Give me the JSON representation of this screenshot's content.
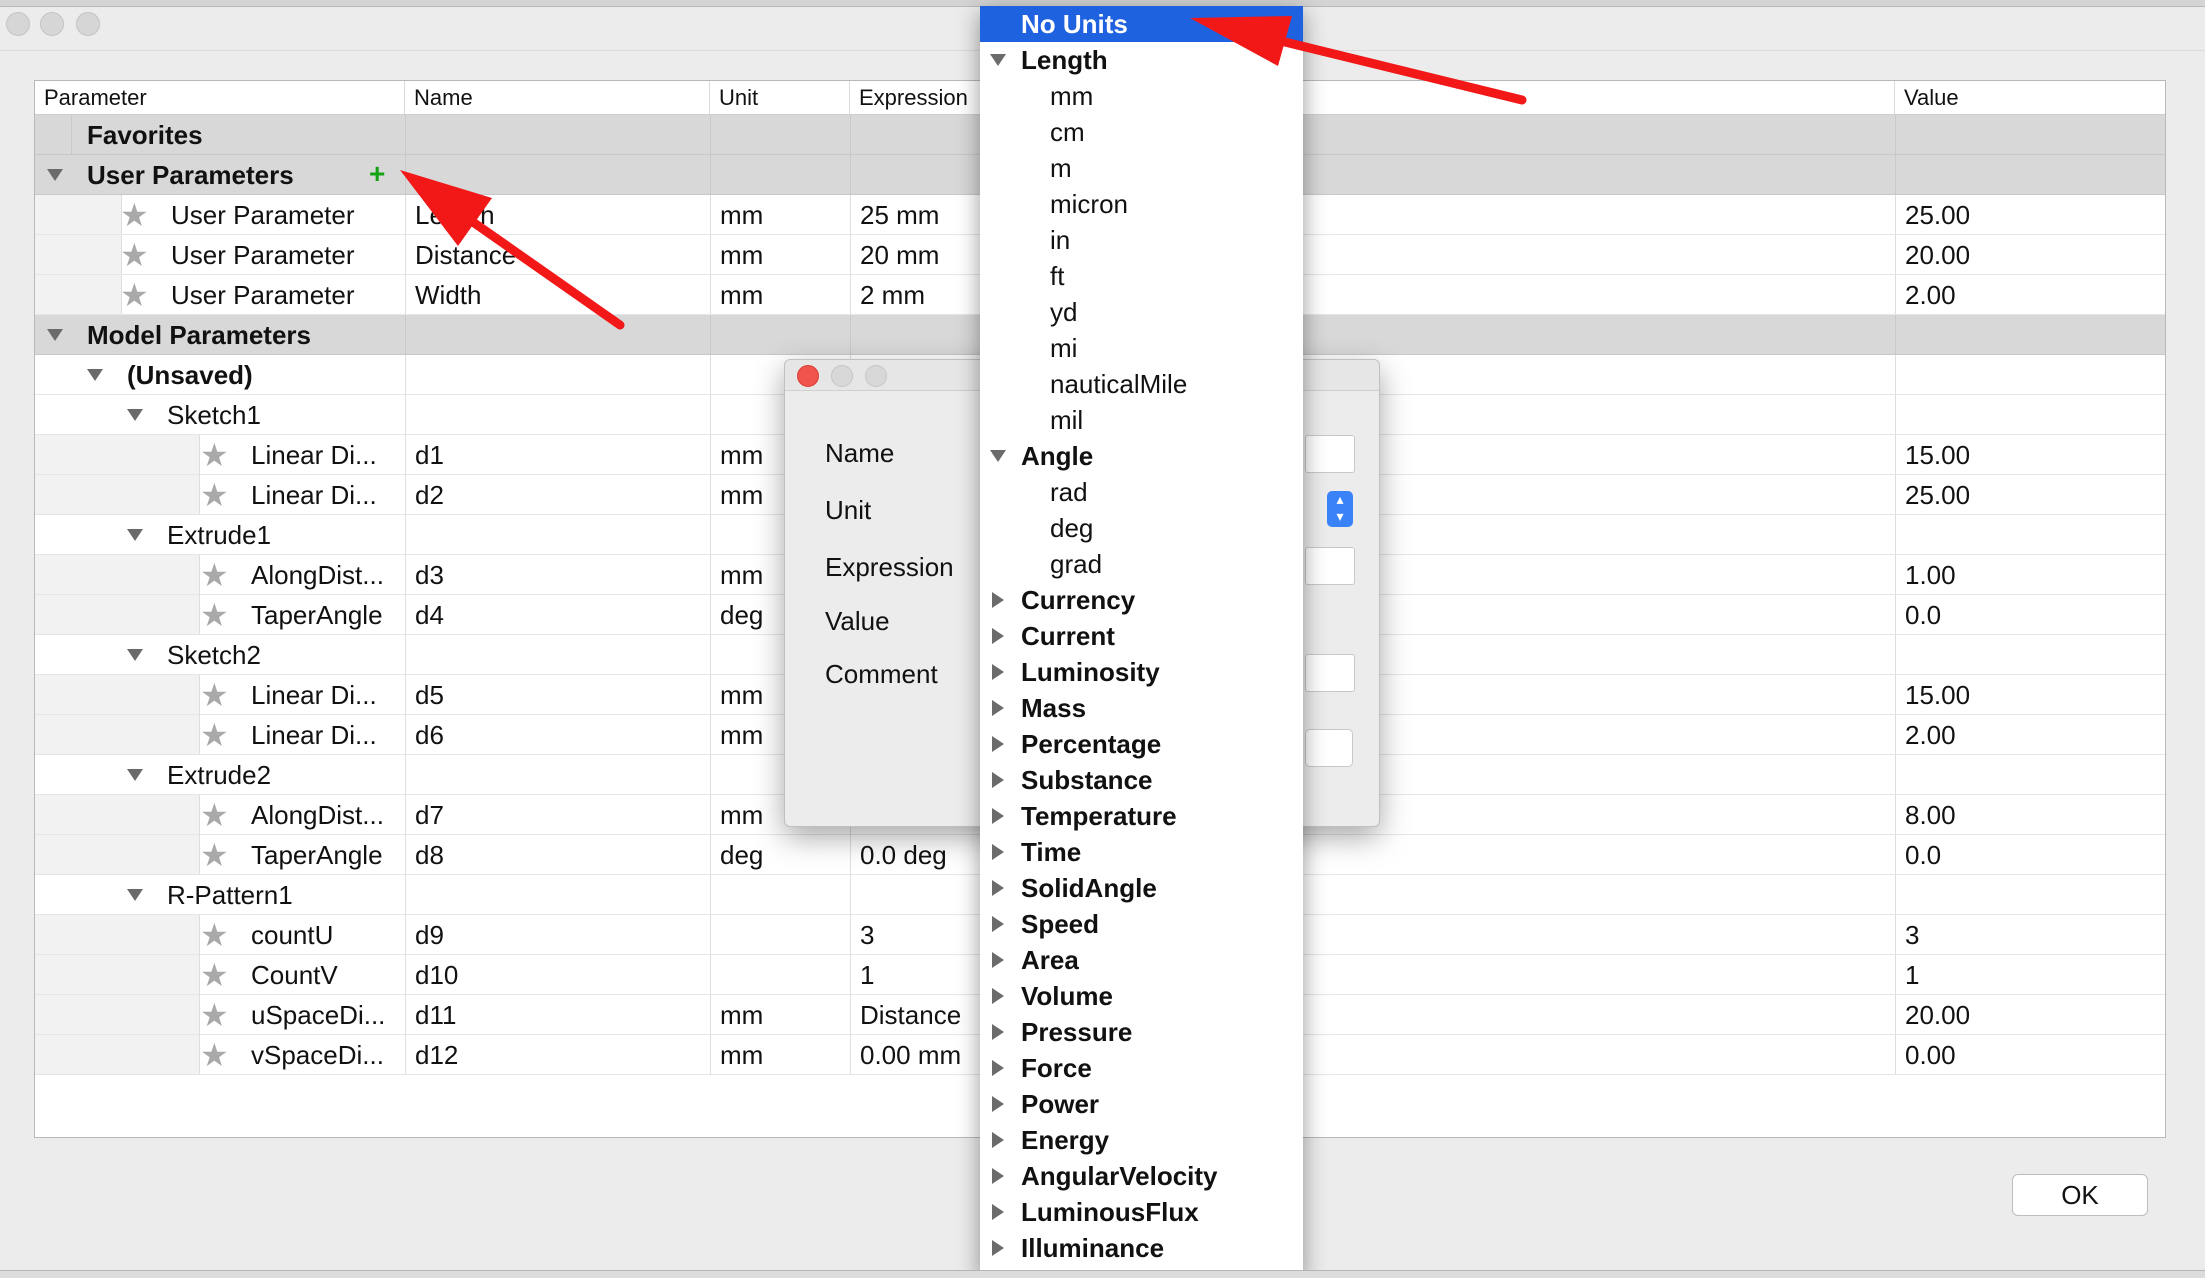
{
  "columns": {
    "parameter": "Parameter",
    "name": "Name",
    "unit": "Unit",
    "expression": "Expression",
    "value": "Value"
  },
  "groups": {
    "favorites": "Favorites",
    "user_parameters": "User Parameters",
    "model_parameters": "Model Parameters"
  },
  "user_rows": [
    {
      "parameter": "User Parameter",
      "name": "Length",
      "unit": "mm",
      "expression": "25 mm",
      "value": "25.00"
    },
    {
      "parameter": "User Parameter",
      "name": "Distance",
      "unit": "mm",
      "expression": "20 mm",
      "value": "20.00"
    },
    {
      "parameter": "User Parameter",
      "name": "Width",
      "unit": "mm",
      "expression": "2 mm",
      "value": "2.00"
    }
  ],
  "model": {
    "unsaved": "(Unsaved)",
    "features": {
      "sketch1": "Sketch1",
      "extrude1": "Extrude1",
      "sketch2": "Sketch2",
      "extrude2": "Extrude2",
      "rpattern1": "R-Pattern1"
    },
    "rows": [
      {
        "parameter": "Linear Di...",
        "name": "d1",
        "unit": "mm",
        "expression": "",
        "value": "15.00"
      },
      {
        "parameter": "Linear Di...",
        "name": "d2",
        "unit": "mm",
        "expression": "",
        "value": "25.00"
      },
      {
        "parameter": "AlongDist...",
        "name": "d3",
        "unit": "mm",
        "expression": "",
        "value": "1.00"
      },
      {
        "parameter": "TaperAngle",
        "name": "d4",
        "unit": "deg",
        "expression": "",
        "value": "0.0"
      },
      {
        "parameter": "Linear Di...",
        "name": "d5",
        "unit": "mm",
        "expression": "",
        "value": "15.00"
      },
      {
        "parameter": "Linear Di...",
        "name": "d6",
        "unit": "mm",
        "expression": "",
        "value": "2.00"
      },
      {
        "parameter": "AlongDist...",
        "name": "d7",
        "unit": "mm",
        "expression": "",
        "value": "8.00"
      },
      {
        "parameter": "TaperAngle",
        "name": "d8",
        "unit": "deg",
        "expression": "0.0 deg",
        "value": "0.0"
      },
      {
        "parameter": "countU",
        "name": "d9",
        "unit": "",
        "expression": "3",
        "value": "3"
      },
      {
        "parameter": "CountV",
        "name": "d10",
        "unit": "",
        "expression": "1",
        "value": "1"
      },
      {
        "parameter": "uSpaceDi...",
        "name": "d11",
        "unit": "mm",
        "expression": "Distance",
        "value": "20.00"
      },
      {
        "parameter": "vSpaceDi...",
        "name": "d12",
        "unit": "mm",
        "expression": "0.00 mm",
        "value": "0.00"
      }
    ]
  },
  "dialog": {
    "labels": {
      "name": "Name",
      "unit": "Unit",
      "expression": "Expression",
      "value": "Value",
      "comment": "Comment"
    }
  },
  "unit_menu": {
    "selected": "No Units",
    "length": {
      "label": "Length",
      "units": [
        "mm",
        "cm",
        "m",
        "micron",
        "in",
        "ft",
        "yd",
        "mi",
        "nauticalMile",
        "mil"
      ]
    },
    "angle": {
      "label": "Angle",
      "units": [
        "rad",
        "deg",
        "grad"
      ]
    },
    "categories": [
      "Currency",
      "Current",
      "Luminosity",
      "Mass",
      "Percentage",
      "Substance",
      "Temperature",
      "Time",
      "SolidAngle",
      "Speed",
      "Area",
      "Volume",
      "Pressure",
      "Force",
      "Power",
      "Energy",
      "AngularVelocity",
      "LuminousFlux",
      "Illuminance"
    ]
  },
  "ok_label": "OK",
  "colors": {
    "accent_selected": "#1f62e0",
    "annotation_arrow": "#f21818",
    "add_icon": "#14a314",
    "group_row": "#d8d8d8"
  }
}
